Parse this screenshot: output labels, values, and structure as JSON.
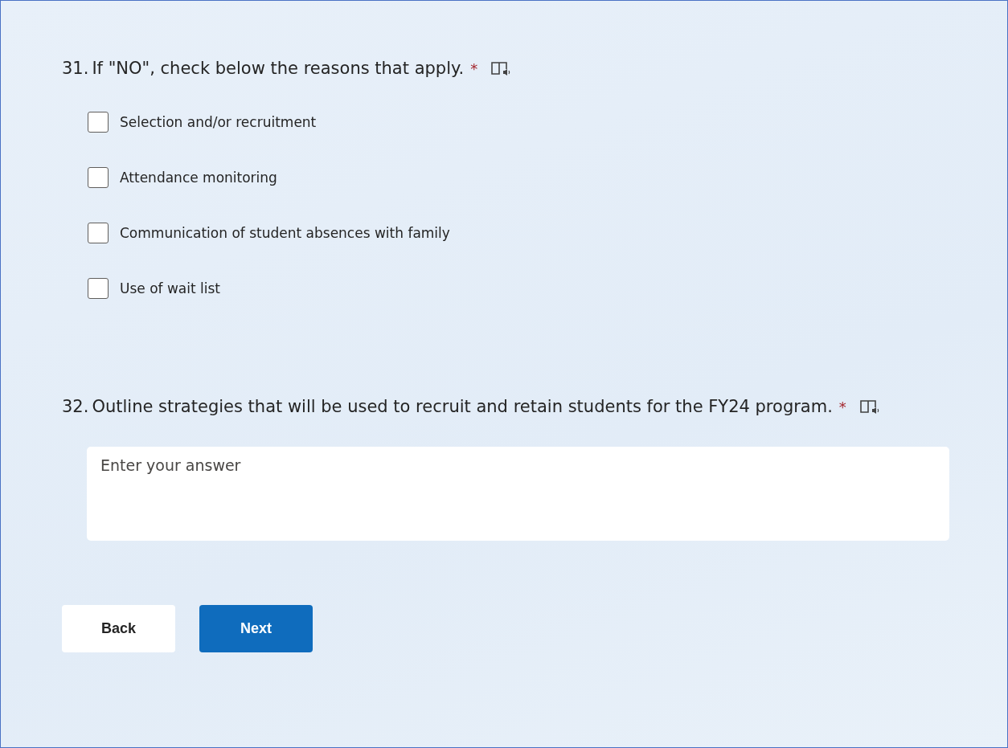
{
  "questions": [
    {
      "number": "31.",
      "text": "If \"NO\", check below the reasons that apply.",
      "required_mark": "*",
      "kind": "checkboxes",
      "options": [
        {
          "label": "Selection and/or recruitment",
          "checked": false
        },
        {
          "label": "Attendance monitoring",
          "checked": false
        },
        {
          "label": "Communication of student absences with family",
          "checked": false
        },
        {
          "label": "Use of wait list",
          "checked": false
        }
      ]
    },
    {
      "number": "32.",
      "text": "Outline strategies that will be used to recruit and retain students for the FY24 program.",
      "required_mark": "*",
      "kind": "text",
      "placeholder": "Enter your answer"
    }
  ],
  "buttons": [
    {
      "label": "Back",
      "kind": "secondary"
    },
    {
      "label": "Next",
      "kind": "primary"
    }
  ]
}
